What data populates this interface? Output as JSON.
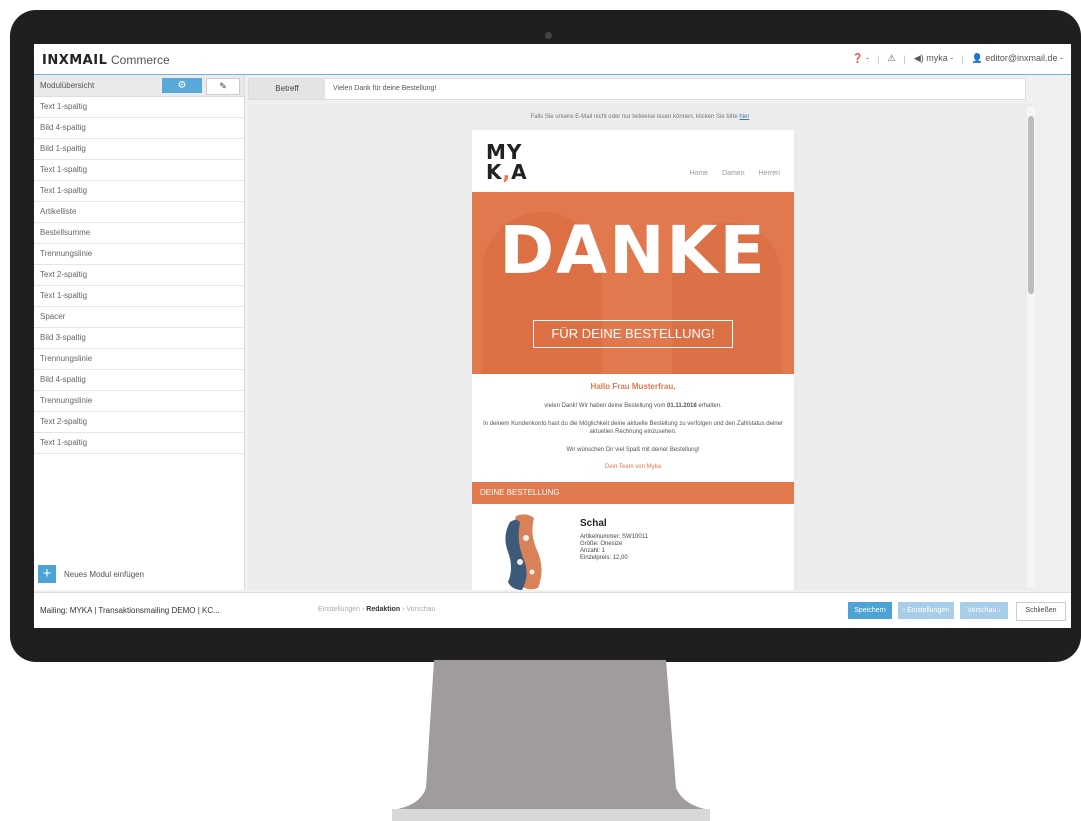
{
  "app": {
    "logo_brand": "INXMAIL",
    "logo_product": "Commerce",
    "topbar": {
      "help": "❓ -",
      "alerts": "⚠",
      "sound": "◀) myka -",
      "user": "👤 editor@inxmail.de -"
    }
  },
  "sidebar": {
    "header_label": "Modulübersicht",
    "items": [
      "Text 1-spaltig",
      "Bild 4-spaltig",
      "Bild 1-spaltig",
      "Text 1-spaltig",
      "Text 1-spaltig",
      "Artikelliste",
      "Bestellsumme",
      "Trennungslinie",
      "Text 2-spaltig",
      "Text 1-spaltig",
      "Spacer",
      "Bild 3-spaltig",
      "Trennungslinie",
      "Bild 4-spaltig",
      "Trennungslinie",
      "Text 2-spaltig",
      "Text 1-spaltig"
    ],
    "add_module": "Neues Modul einfügen"
  },
  "subject": {
    "label": "Betreff",
    "value": "Vielen Dank für deine Bestellung!"
  },
  "preview": {
    "hint": "Falls Sie unsere E-Mail nicht oder nur teilweise lesen können, klicken Sie bitte",
    "hint_link": "hier",
    "brand_line1": "MY",
    "brand_line2_a": "K",
    "brand_line2_comma": ",",
    "brand_line2_b": "A",
    "nav": [
      "Home",
      "Damen",
      "Herren"
    ],
    "hero_title": "DANKE",
    "hero_subtitle": "FÜR DEINE BESTELLUNG!",
    "greeting": "Hallo Frau Musterfrau,",
    "text1_prefix": "vielen Dank! Wir haben deine Bestellung vom",
    "text1_date": "01.11.2018",
    "text1_suffix": "erhalten.",
    "text2": "In deinem Kundenkonto hast du die Möglichkeit deine aktuelle Bestellung zu verfolgen und den Zahlstatus deiner aktuellen Rechnung einzusehen.",
    "text3": "Wir wünschen Dir viel Spaß mit deiner Bestellung!",
    "sign": "Dein Team von Myka",
    "order_title": "DEINE BESTELLUNG",
    "product": {
      "name": "Schal",
      "number": "Artikelnummer: SW10011",
      "size": "Größe: Onesize",
      "qty": "Anzahl: 1",
      "price": "Einzelpreis: 12,00"
    }
  },
  "bottombar": {
    "mailing": "Mailing: MYKA | Transaktionsmailing DEMO | KC...",
    "step1": "Einstellungen",
    "step2": "Redaktion",
    "step3": "Vorschau",
    "save": "Speichern",
    "settings": "‹ Einstellungen",
    "preview": "Vorschau ›",
    "close": "Schließen"
  },
  "colors": {
    "accent": "#e2784d",
    "primary_button": "#4ea3d6",
    "bezel": "#1f1f1f",
    "stand": "#a09c9b"
  }
}
